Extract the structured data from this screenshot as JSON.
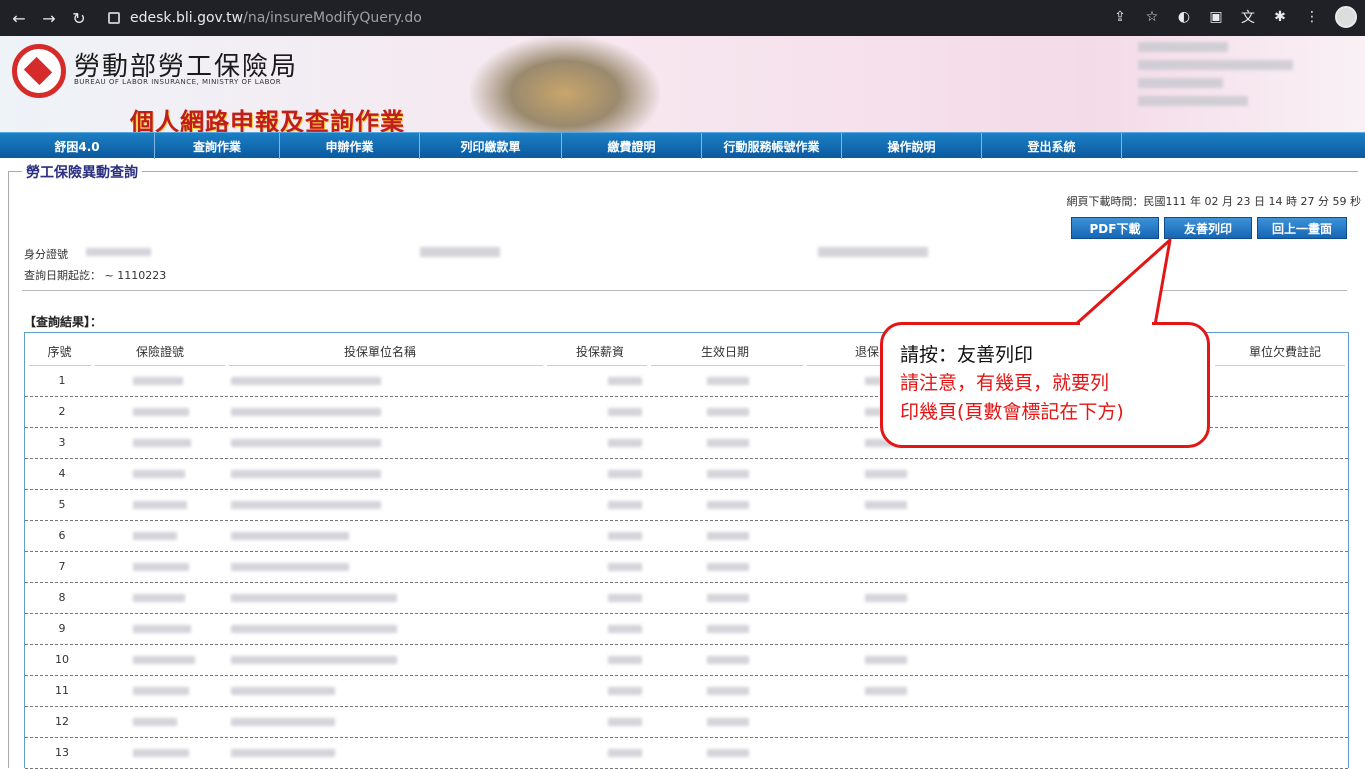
{
  "browser": {
    "url_host": "edesk.bli.gov.tw",
    "url_path": "/na/insureModifyQuery.do"
  },
  "site": {
    "title": "勞動部勞工保險局",
    "subtitle": "BUREAU OF LABOR INSURANCE, MINISTRY OF LABOR",
    "slogan": "個人網路申報及查詢作業"
  },
  "menu": [
    {
      "label": "舒困4.0"
    },
    {
      "label": "查詢作業"
    },
    {
      "label": "申辦作業"
    },
    {
      "label": "列印繳款單"
    },
    {
      "label": "繳費證明"
    },
    {
      "label": "行動服務帳號作業"
    },
    {
      "label": "操作說明"
    },
    {
      "label": "登出系統"
    }
  ],
  "page": {
    "section_title": "勞工保險異動查詢",
    "download_time": "網頁下載時間：民國111 年 02 月 23 日 14 時 27 分 59 秒",
    "buttons": {
      "pdf": "PDF下載",
      "print": "友善列印",
      "back": "回上一畫面"
    },
    "id_label": "身分證號",
    "query_date": "查詢日期起訖： ~ 1110223",
    "result_label": "【查詢結果】："
  },
  "table": {
    "headers": [
      "序號",
      "保險證號",
      "投保單位名稱",
      "投保薪資",
      "生效日期",
      "退保",
      "單位欠費註記"
    ],
    "rows": [
      "1",
      "2",
      "3",
      "4",
      "5",
      "6",
      "7",
      "8",
      "9",
      "10",
      "11",
      "12",
      "13"
    ]
  },
  "callout": {
    "line1": "請按：友善列印",
    "line2": "請注意，有幾頁，就要列",
    "line3": "印幾頁(頁數會標記在下方)"
  }
}
